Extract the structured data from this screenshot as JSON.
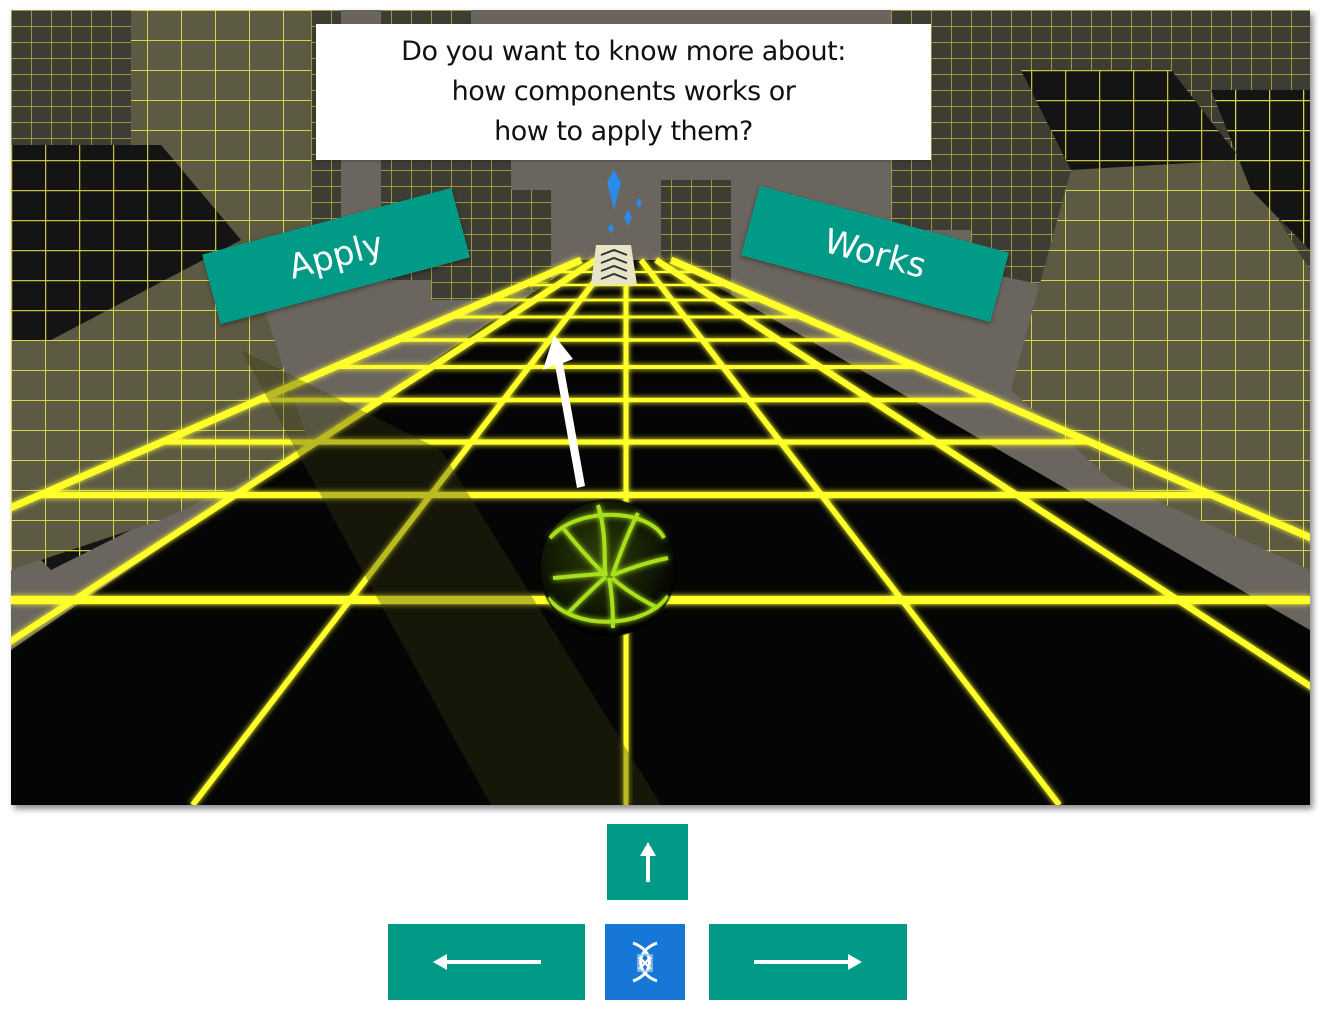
{
  "question": {
    "lines": [
      "Do you want to know more about:",
      "how components works or",
      "how to apply them?"
    ]
  },
  "signs": {
    "apply_label": "Apply",
    "works_label": "Works"
  },
  "controls": {
    "up": "arrow-up-icon",
    "left": "arrow-left-icon",
    "right": "arrow-right-icon",
    "center": "reset-icon"
  },
  "colors": {
    "grid_yellow": "#ffff2a",
    "button_teal": "#009a86",
    "button_blue": "#1677d6",
    "sky": "#6b655f",
    "gem": "#2a8be8"
  }
}
